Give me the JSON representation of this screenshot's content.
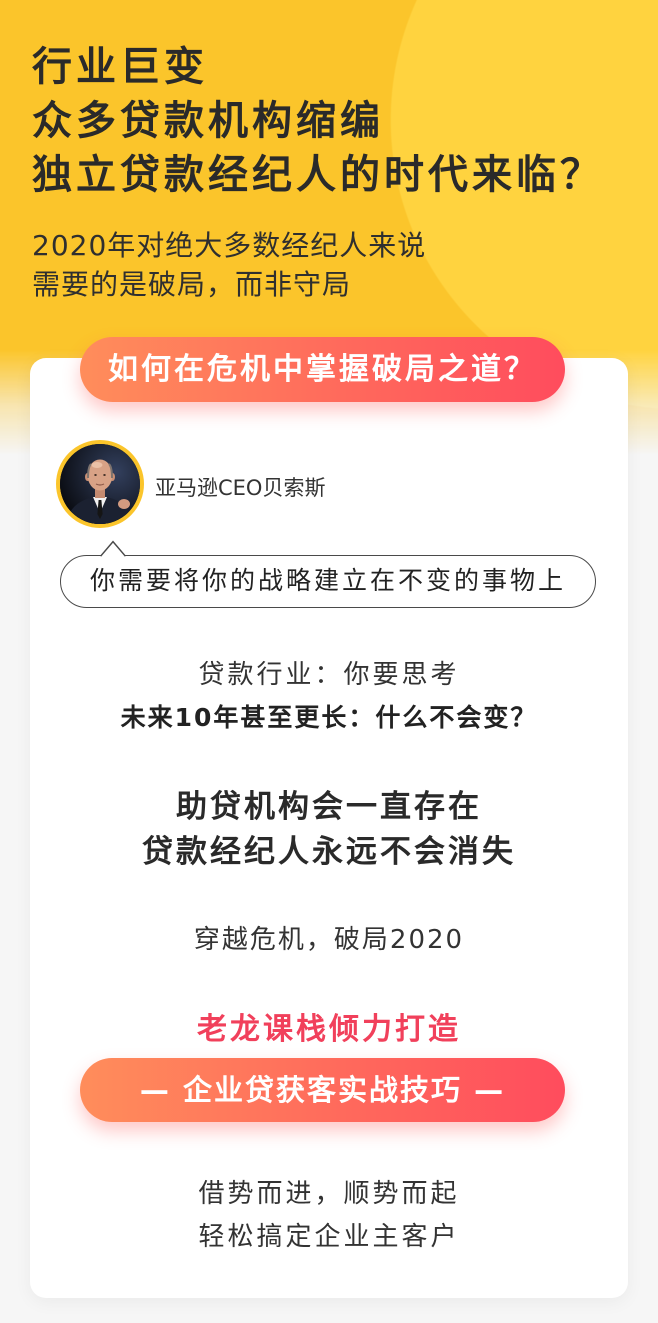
{
  "headline": {
    "lines": [
      "行业巨变",
      "众多贷款机构缩编",
      "独立贷款经纪人的时代来临？"
    ]
  },
  "subtitle": {
    "lines": [
      "2020年对绝大多数经纪人来说",
      "需要的是破局，而非守局"
    ]
  },
  "question_badge": "如何在危机中掌握破局之道？",
  "quote": {
    "avatar": "person-portrait",
    "speaker": "亚马逊CEO贝索斯",
    "text": "你需要将你的战略建立在不变的事物上"
  },
  "reflection": {
    "line1": "贷款行业：你要思考",
    "line2": "未来10年甚至更长：什么不会变？"
  },
  "statement": {
    "lines": [
      "助贷机构会一直存在",
      "贷款经纪人永远不会消失"
    ]
  },
  "tagline": "穿越危机，破局2020",
  "producer": "老龙课栈倾力打造",
  "course_banner": "— 企业贷获客实战技巧 —",
  "closing": {
    "lines": [
      "借势而进，顺势而起",
      "轻松搞定企业主客户"
    ]
  },
  "colors": {
    "yellow": "#FBC52B",
    "yellow_light": "#FFD33F",
    "accent_start": "#FF8D5B",
    "accent_end": "#FF4C5D",
    "producer_red": "#F1405B",
    "text_dark": "#2A2A2A"
  }
}
